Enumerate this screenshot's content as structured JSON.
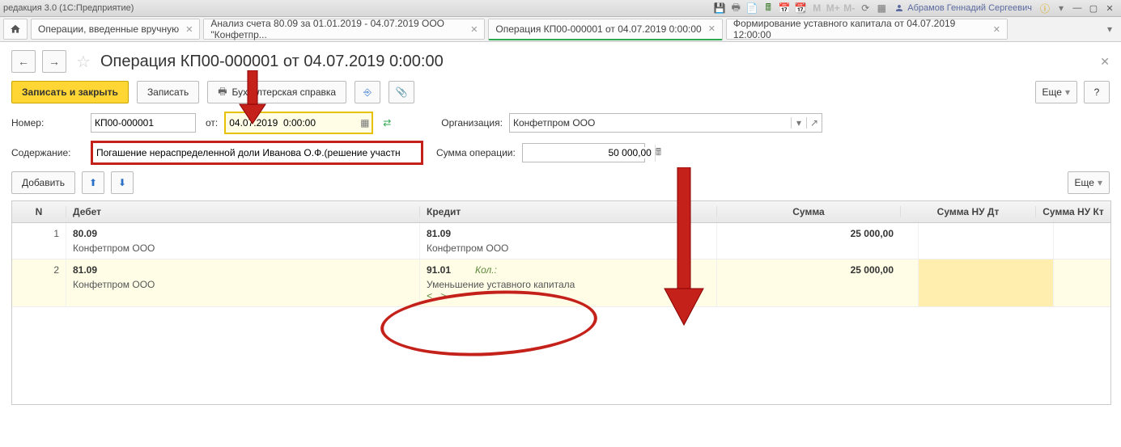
{
  "titlebar": {
    "text": "редакция 3.0  (1С:Предприятие)",
    "user": "Абрамов Геннадий Сергеевич"
  },
  "tabs": [
    {
      "label": "Операции, введенные вручную"
    },
    {
      "label": "Анализ счета 80.09 за 01.01.2019 - 04.07.2019 ООО \"Конфетпр..."
    },
    {
      "label": "Операция КП00-000001 от 04.07.2019 0:00:00",
      "active": true
    },
    {
      "label": "Формирование уставного капитала от 04.07.2019 12:00:00"
    }
  ],
  "page": {
    "title": "Операция КП00-000001 от 04.07.2019 0:00:00"
  },
  "toolbar": {
    "save_close": "Записать и закрыть",
    "save": "Записать",
    "report": "Бухгалтерская справка",
    "more": "Еще",
    "help": "?"
  },
  "form": {
    "number_label": "Номер:",
    "number_value": "КП00-000001",
    "date_label": "от:",
    "date_value": "04.07.2019  0:00:00",
    "org_label": "Организация:",
    "org_value": "Конфетпром ООО",
    "desc_label": "Содержание:",
    "desc_value": "Погашение нераспределенной доли Иванова О.Ф.(решение участн",
    "sum_label": "Сумма операции:",
    "sum_value": "50 000,00"
  },
  "add": {
    "label": "Добавить",
    "more": "Еще"
  },
  "table": {
    "headers": {
      "n": "N",
      "debit": "Дебет",
      "credit": "Кредит",
      "sum": "Сумма",
      "nu_dt": "Сумма НУ Дт",
      "nu_kt": "Сумма НУ Кт"
    },
    "rows": [
      {
        "n": "1",
        "debit_acct": "80.09",
        "debit_sub": "Конфетпром ООО",
        "credit_acct": "81.09",
        "credit_sub": "Конфетпром ООО",
        "sum": "25 000,00"
      },
      {
        "n": "2",
        "debit_acct": "81.09",
        "debit_sub": "Конфетпром ООО",
        "credit_acct": "91.01",
        "credit_kol": "Кол.:",
        "credit_sub": "Уменьшение уставного капитала",
        "credit_extra": "<...>",
        "sum": "25 000,00",
        "selected": true
      }
    ]
  }
}
